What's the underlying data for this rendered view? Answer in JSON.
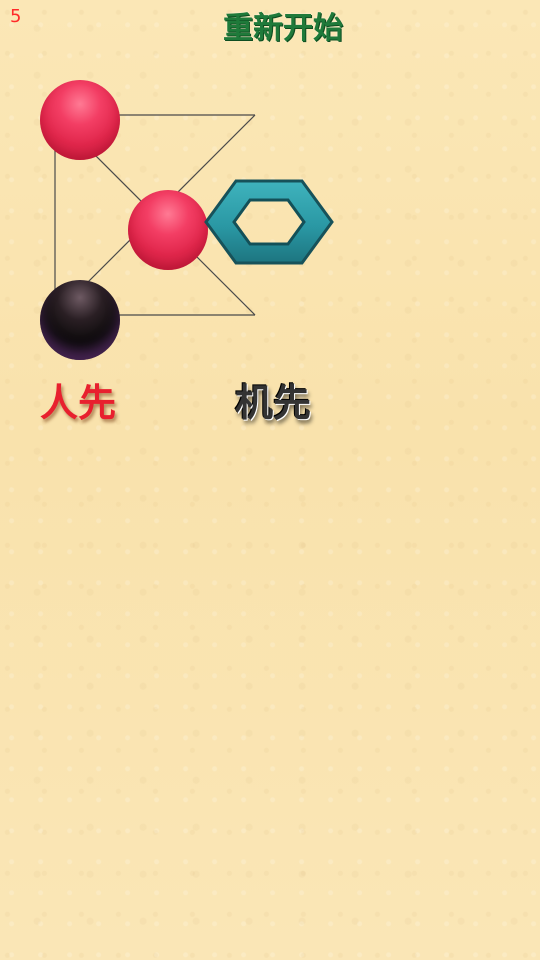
{
  "status": {
    "counter": "5"
  },
  "header": {
    "restart_label": "重新开始"
  },
  "board": {
    "pieces": [
      {
        "color": "red",
        "node": "top-left"
      },
      {
        "color": "red",
        "node": "center"
      },
      {
        "color": "black",
        "node": "bottom-left"
      }
    ],
    "marker_icon": "hexagon-icon",
    "colors": {
      "red_piece": "#e0264b",
      "black_piece": "#0c0a0b",
      "hex_marker": "#2a9aa6",
      "line": "#4a4a4a"
    }
  },
  "choices": {
    "human_first": "人先",
    "computer_first": "机先"
  },
  "colors": {
    "background": "#fbe5b1",
    "restart_text": "#1f7a3a",
    "counter_text": "#ff2a2a",
    "human_text": "#e8202e",
    "computer_text": "#333333"
  }
}
